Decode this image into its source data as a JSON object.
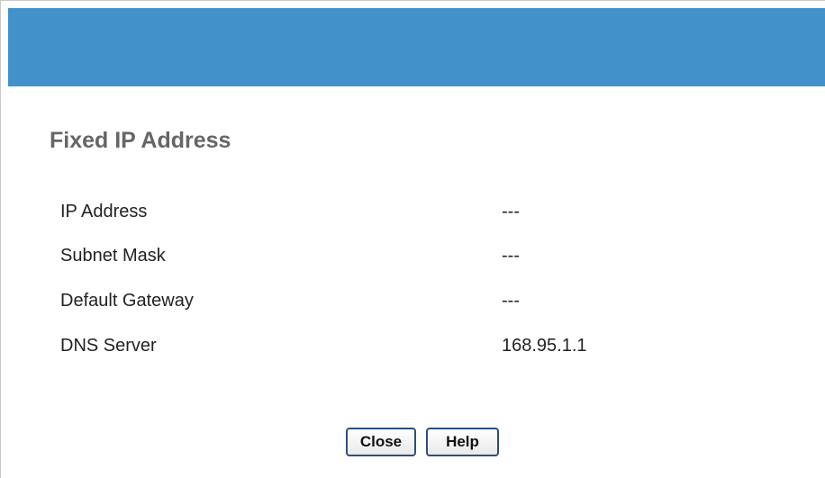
{
  "header": {
    "title": "Fixed IP Address"
  },
  "fields": [
    {
      "label": "IP Address",
      "value": "---"
    },
    {
      "label": "Subnet Mask",
      "value": "---"
    },
    {
      "label": "Default Gateway",
      "value": "---"
    },
    {
      "label": "DNS Server",
      "value": "168.95.1.1"
    }
  ],
  "buttons": {
    "close_label": "Close",
    "help_label": "Help"
  },
  "colors": {
    "header_bar": "#4391ca",
    "title_text": "#666666"
  }
}
